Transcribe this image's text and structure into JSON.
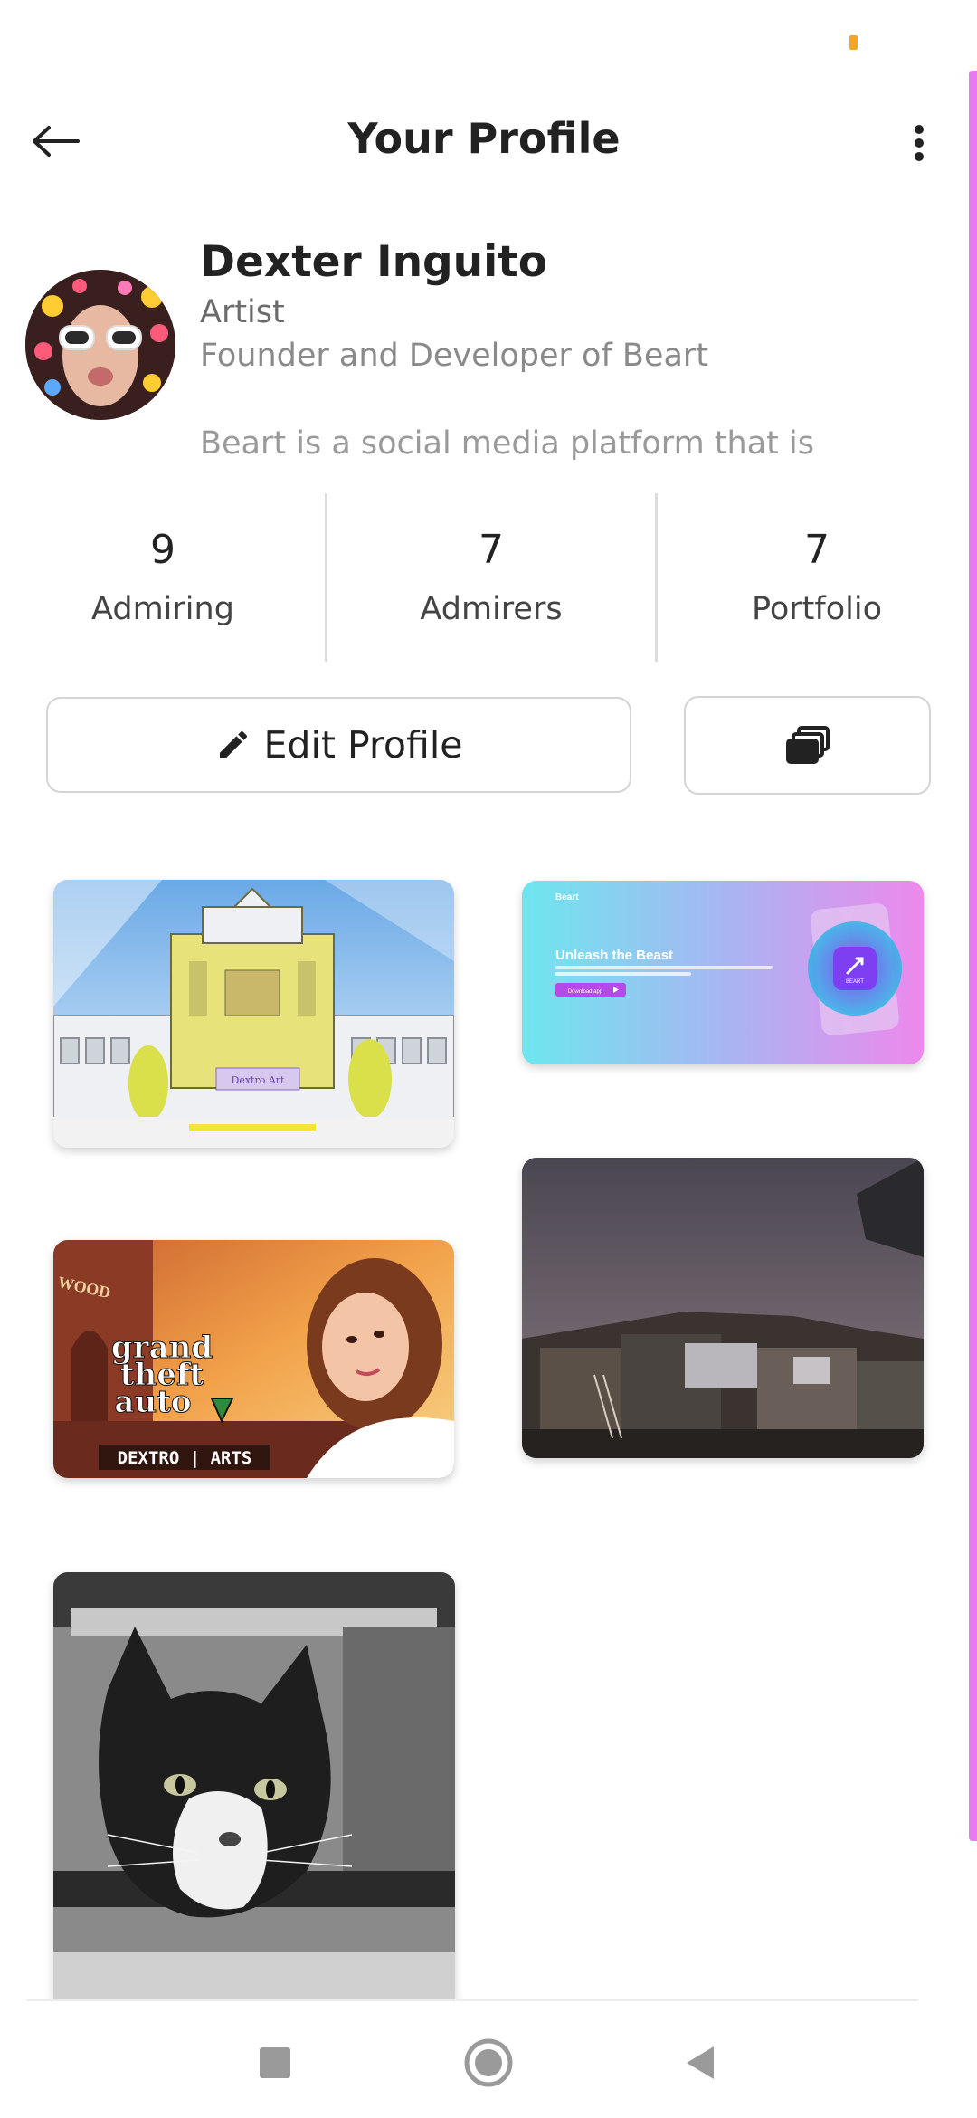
{
  "header": {
    "title": "Your Profile"
  },
  "profile": {
    "name": "Dexter Inguito",
    "role": "Artist",
    "tagline": "Founder and Developer of Beart",
    "bio": "Beart is a social media platform that is"
  },
  "stats": [
    {
      "value": "9",
      "label": "Admiring"
    },
    {
      "value": "7",
      "label": "Admirers"
    },
    {
      "value": "7",
      "label": "Portfolio"
    }
  ],
  "actions": {
    "edit_label": "Edit Profile"
  },
  "posts": {
    "building_sign": "Dextro Art",
    "beart_brand": "Beart",
    "beart_headline": "Unleash the Beast",
    "beart_button": "Download app",
    "beart_logo_text": "BEART",
    "gta_logo_line1": "grand",
    "gta_logo_line2": "theft",
    "gta_logo_line3": "auto",
    "gta_footer": "DEXTRO | ARTS",
    "gta_street_sign": "WOOD"
  },
  "icons": {
    "back": "arrow-left-icon",
    "menu": "more-vertical-icon",
    "edit": "pencil-icon",
    "share": "copy-stack-icon",
    "nav_recents": "square-icon",
    "nav_home": "circle-icon",
    "nav_back": "triangle-back-icon"
  },
  "colors": {
    "accent_scroll": "#e879f0",
    "status_dot": "#f5a623"
  }
}
